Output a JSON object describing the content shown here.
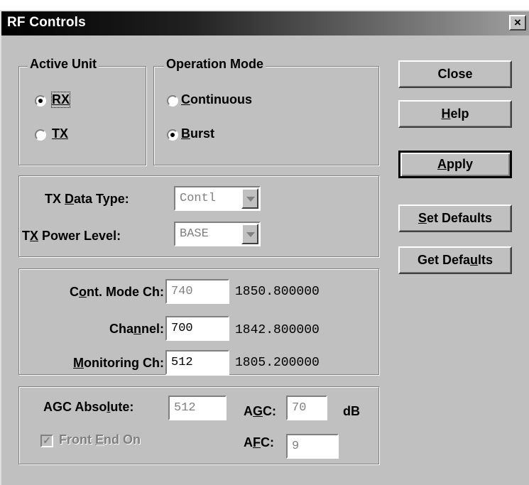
{
  "window": {
    "title": "RF Controls",
    "close_glyph": "×"
  },
  "active_unit": {
    "legend": "Active Unit",
    "options": [
      {
        "label": "RX",
        "mnemonic": "R",
        "selected": true
      },
      {
        "label": "TX",
        "mnemonic": "T",
        "selected": false
      }
    ]
  },
  "operation_mode": {
    "legend": "Operation Mode",
    "options": [
      {
        "label": "Continuous",
        "mnemonic": "C",
        "selected": false
      },
      {
        "label": "Burst",
        "mnemonic": "B",
        "selected": true
      }
    ]
  },
  "tx_settings": {
    "data_type_label_pre": "TX ",
    "data_type_label_mn": "D",
    "data_type_label_post": "ata Type:",
    "data_type_value": "Contl",
    "power_label_pre": "T",
    "power_label_mn": "X",
    "power_label_post": " Power Level:",
    "power_value": "BASE"
  },
  "channels": {
    "cont_label_pre": "C",
    "cont_label_mn": "o",
    "cont_label_post": "nt. Mode Ch:",
    "cont_value": "740",
    "cont_freq": "1850.800000",
    "channel_label_pre": "Cha",
    "channel_label_mn": "n",
    "channel_label_post": "nel:",
    "channel_value": "700",
    "channel_freq": "1842.800000",
    "monitoring_label_mn": "M",
    "monitoring_label_post": "onitoring Ch:",
    "monitoring_value": "512",
    "monitoring_freq": "1805.200000"
  },
  "agc": {
    "absolute_label_pre": "AGC Abso",
    "absolute_label_mn": "l",
    "absolute_label_post": "ute:",
    "absolute_value": "512",
    "agc_label_pre": "A",
    "agc_label_mn": "G",
    "agc_label_post": "C:",
    "agc_value": "70",
    "agc_unit": "dB",
    "afc_label_pre": "A",
    "afc_label_mn": "F",
    "afc_label_post": "C:",
    "afc_value": "9",
    "front_end_pre": "Front ",
    "front_end_mn": "E",
    "front_end_post": "nd On",
    "front_end_checked": true,
    "check_glyph": "✓"
  },
  "buttons": {
    "close": "Close",
    "help_mn": "H",
    "help_post": "elp",
    "apply_mn": "A",
    "apply_post": "pply",
    "set_defaults_mn": "S",
    "set_defaults_post": "et Defaults",
    "get_defaults_pre": "Get Defa",
    "get_defaults_mn": "u",
    "get_defaults_post": "lts"
  }
}
